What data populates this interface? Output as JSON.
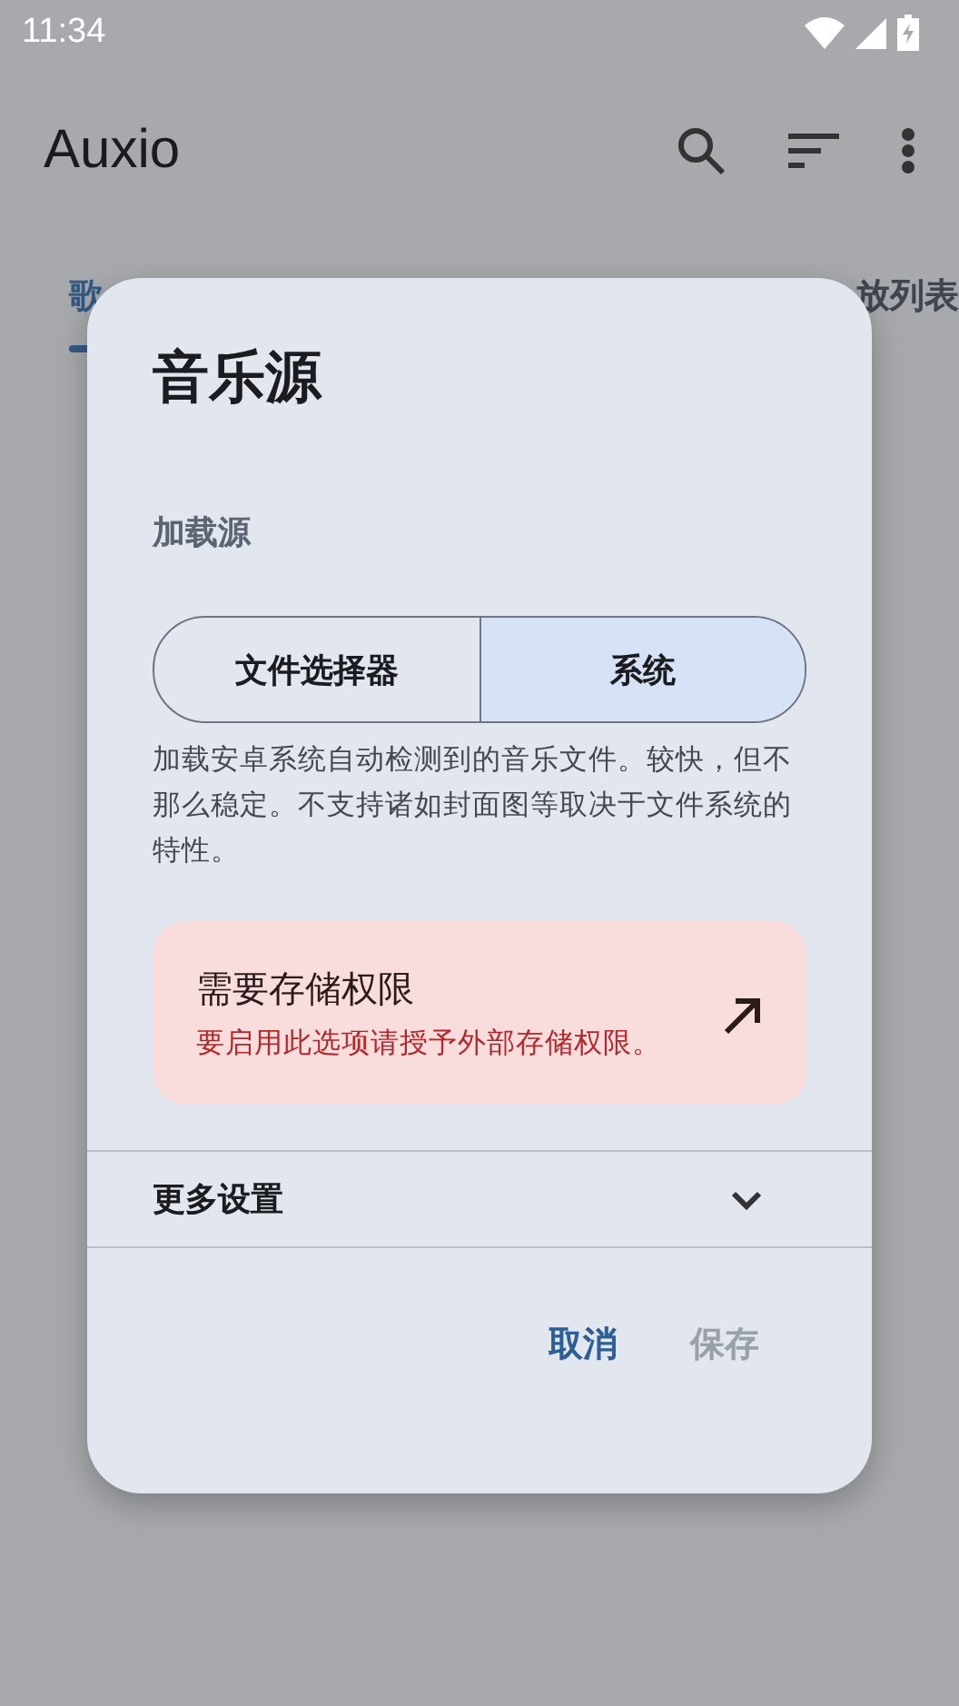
{
  "status_bar": {
    "time": "11:34"
  },
  "toolbar": {
    "title": "Auxio"
  },
  "tabs": [
    {
      "label": "歌",
      "selected": true
    },
    {
      "label": "放列表",
      "selected": false
    }
  ],
  "dialog": {
    "title": "音乐源",
    "section_label": "加载源",
    "options": [
      {
        "label": "文件选择器",
        "selected": false
      },
      {
        "label": "系统",
        "selected": true
      }
    ],
    "description": "加载安卓系统自动检测到的音乐文件。较快，但不那么稳定。不支持诸如封面图等取决于文件系统的特性。",
    "warning": {
      "title": "需要存储权限",
      "message": "要启用此选项请授予外部存储权限。"
    },
    "more_settings": {
      "label": "更多设置",
      "expanded": false
    },
    "buttons": [
      {
        "label": "取消",
        "disabled": false
      },
      {
        "label": "保存",
        "disabled": true
      }
    ]
  }
}
